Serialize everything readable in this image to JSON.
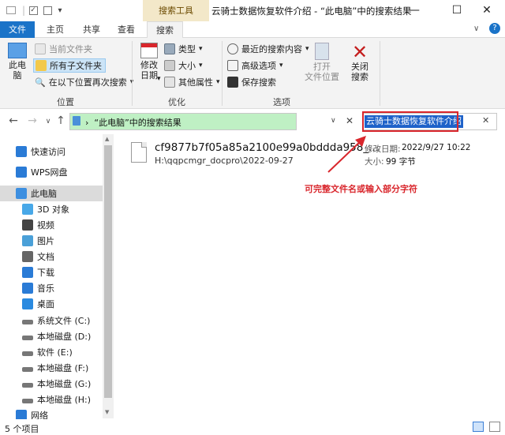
{
  "window": {
    "title": "云骑士数据恢复软件介绍 - “此电脑”中的搜索结果",
    "context_tab": "搜索工具",
    "controls": {
      "minimize": "—",
      "maximize": "☐",
      "close": "✕"
    }
  },
  "tabs": [
    "文件",
    "主页",
    "共享",
    "查看",
    "搜索"
  ],
  "ribbon": {
    "location": {
      "label": "位置",
      "this_pc": "此电\n脑",
      "current_folder": "当前文件夹",
      "all_subfolders": "所有子文件夹",
      "search_again": "在以下位置再次搜索"
    },
    "refine": {
      "label": "优化",
      "modified": "修改\n日期",
      "kind": "类型",
      "size": "大小",
      "other": "其他属性"
    },
    "options": {
      "label": "选项",
      "recent": "最近的搜索内容",
      "advanced": "高级选项",
      "save": "保存搜索",
      "open_location": "打开\n文件位置",
      "close_search": "关闭\n搜索"
    }
  },
  "address": {
    "path": "“此电脑”中的搜索结果",
    "search_query": "云骑士数据恢复软件介绍"
  },
  "sidebar": {
    "items": [
      {
        "label": "快速访问",
        "icon": "star-icon"
      },
      {
        "label": "WPS网盘",
        "icon": "cloud-icon"
      },
      {
        "label": "此电脑",
        "icon": "computer-icon"
      },
      {
        "label": "3D 对象",
        "icon": "cube-icon"
      },
      {
        "label": "视频",
        "icon": "video-icon"
      },
      {
        "label": "图片",
        "icon": "picture-icon"
      },
      {
        "label": "文档",
        "icon": "document-icon"
      },
      {
        "label": "下载",
        "icon": "download-icon"
      },
      {
        "label": "音乐",
        "icon": "music-icon"
      },
      {
        "label": "桌面",
        "icon": "desktop-icon"
      },
      {
        "label": "系统文件 (C:)",
        "icon": "drive-icon"
      },
      {
        "label": "本地磁盘 (D:)",
        "icon": "drive-icon"
      },
      {
        "label": "软件 (E:)",
        "icon": "drive-icon"
      },
      {
        "label": "本地磁盘 (F:)",
        "icon": "drive-icon"
      },
      {
        "label": "本地磁盘 (G:)",
        "icon": "drive-icon"
      },
      {
        "label": "本地磁盘 (H:)",
        "icon": "drive-icon"
      },
      {
        "label": "网络",
        "icon": "network-icon"
      }
    ]
  },
  "result": {
    "name": "cf9877b7f05a85a2100e99a0bddda958_...",
    "path": "H:\\qqpcmgr_docpro\\2022-09-27",
    "modified_label": "修改日期:",
    "modified_value": "2022/9/27 10:22",
    "size_label": "大小:",
    "size_value": "99 字节"
  },
  "annotation": "可完整文件名或输入部分字符",
  "status": {
    "count": "5 个项目"
  },
  "colors": {
    "accent": "#1a73c8",
    "annotation_red": "#d9262c",
    "address_bg": "#bff0c4",
    "selection": "#1e62c9"
  }
}
